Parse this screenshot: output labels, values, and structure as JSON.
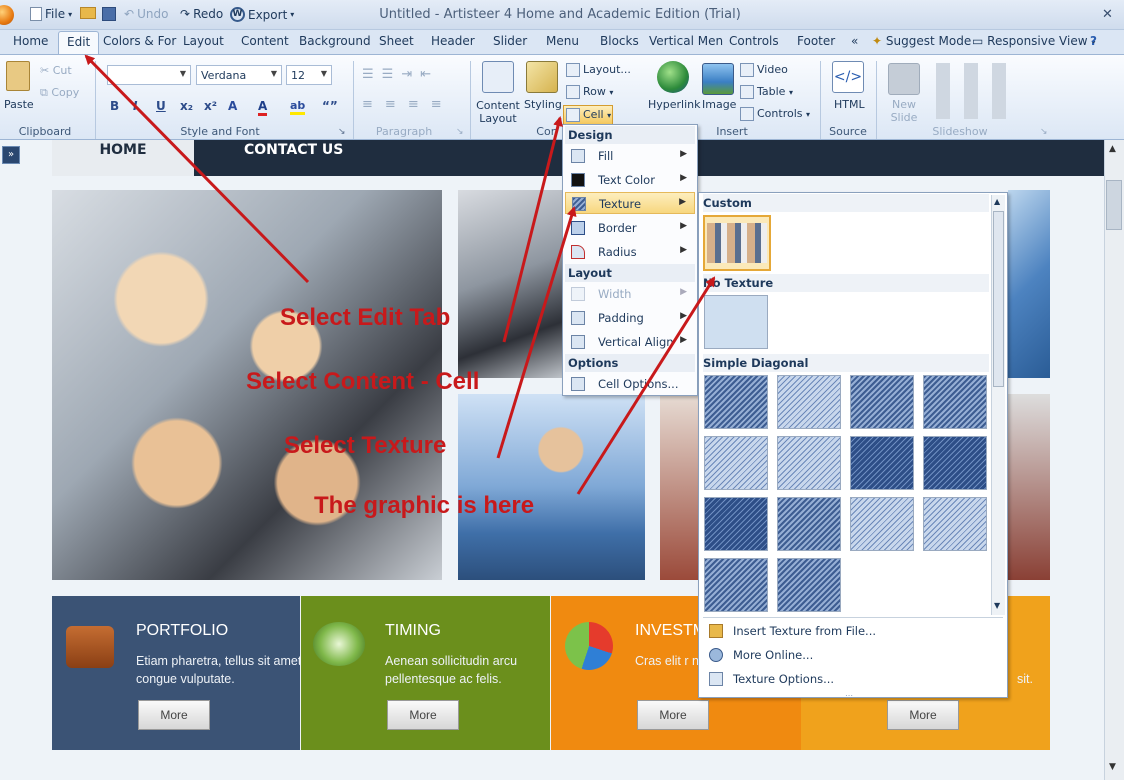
{
  "titlebar": {
    "file": "File",
    "undo": "Undo",
    "redo": "Redo",
    "export": "Export",
    "title": "Untitled - Artisteer 4 Home and Academic Edition (Trial)"
  },
  "tabs": [
    "Home",
    "Edit",
    "Colors & For",
    "Layout",
    "Content",
    "Background",
    "Sheet",
    "Header",
    "Slider",
    "Menu",
    "Blocks",
    "Vertical Men",
    "Controls",
    "Footer"
  ],
  "tab_overflow": "«",
  "suggest_mode": "Suggest Mode",
  "responsive_view": "Responsive View",
  "help": "?",
  "ribbon": {
    "clipboard": {
      "paste": "Paste",
      "cut": "Cut",
      "copy": "Copy",
      "label": "Clipboard"
    },
    "font": {
      "face": "Verdana",
      "size": "12",
      "label": "Style and Font",
      "bold": "B",
      "italic": "I",
      "underline": "U",
      "sub": "x₂",
      "sup": "x²",
      "quote": "“”"
    },
    "paragraph": {
      "label": "Paragraph"
    },
    "content": {
      "content_layout": "Content Layout",
      "styling": "Styling",
      "layout": "Layout...",
      "row": "Row",
      "cell": "Cell",
      "label": "Con"
    },
    "insert": {
      "hyperlink": "Hyperlink",
      "image": "Image",
      "video": "Video",
      "table": "Table",
      "controls": "Controls",
      "label": "Insert"
    },
    "source": {
      "html": "HTML",
      "label": "Source"
    },
    "slideshow": {
      "new_slide": "New Slide",
      "label": "Slideshow"
    }
  },
  "site": {
    "nav_home": "HOME",
    "nav_contact": "CONTACT US",
    "features": [
      {
        "title": "PORTFOLIO",
        "text": "Etiam pharetra, tellus sit amet congue vulputate.",
        "button": "More",
        "color": "#3b5375"
      },
      {
        "title": "TIMING",
        "text": "Aenean sollicitudin arcu pellentesque ac felis.",
        "button": "More",
        "color": "#6b8f1c"
      },
      {
        "title": "INVESTM",
        "text": "Cras elit r nec rhonc",
        "button": "More",
        "color": "#f08a10"
      },
      {
        "title": "",
        "text": "sit.",
        "button": "More",
        "color": "#f0a21c"
      }
    ]
  },
  "cell_menu": {
    "design_header": "Design",
    "fill": "Fill",
    "text_color": "Text Color",
    "texture": "Texture",
    "border": "Border",
    "radius": "Radius",
    "layout_header": "Layout",
    "width": "Width",
    "padding": "Padding",
    "vertical_align": "Vertical Align",
    "options_header": "Options",
    "cell_options": "Cell Options..."
  },
  "texture_gallery": {
    "custom": "Custom",
    "no_texture": "No Texture",
    "simple_diagonal": "Simple Diagonal",
    "insert_from_file": "Insert Texture from File...",
    "more_online": "More Online...",
    "texture_options": "Texture Options..."
  },
  "annotations": {
    "a1": "Select Edit Tab",
    "a2": "Select Content - Cell",
    "a3": "Select Texture",
    "a4": "The graphic is here"
  },
  "colors": {
    "annotation": "#c8191b",
    "ribbon_bg": "#dce7f5",
    "nav": "#1f2d3f",
    "highlight": "#f7d77f"
  }
}
